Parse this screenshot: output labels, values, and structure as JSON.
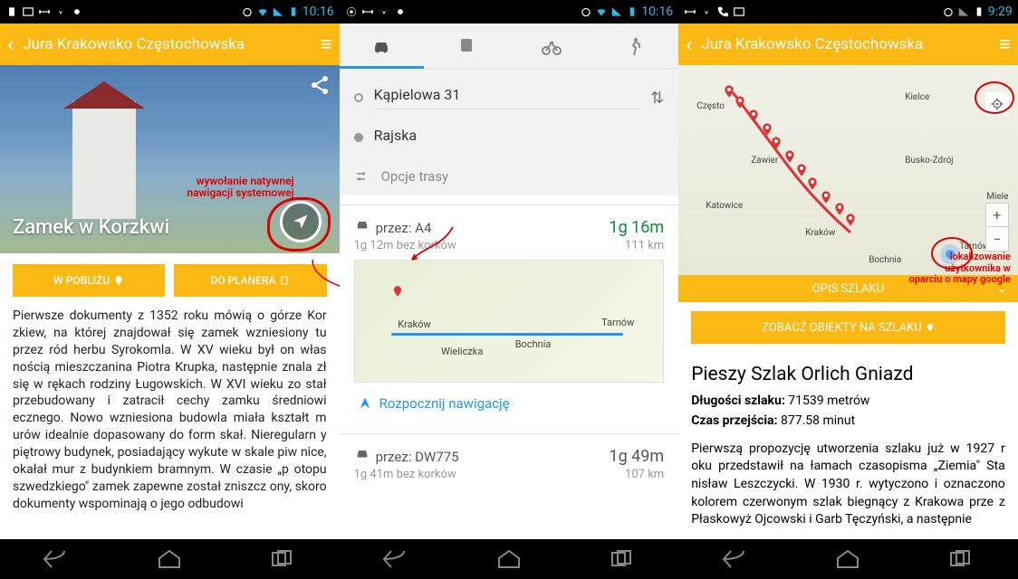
{
  "screen1": {
    "status_time": "10:16",
    "header_title": "Jura Krakowsko Częstochowska",
    "hero_title": "Zamek w Korzkwi",
    "annot_nav": "wywołanie natywnej\nnawigacji systemowej",
    "btn_nearby": "W POBLIŻU",
    "btn_planner": "DO PLANERA",
    "body": "Pierwsze dokumenty z 1352 roku mówią o górze Kor zkiew, na której znajdował się zamek wzniesiony tu przez ród herbu Syrokomla. W XV wieku był on włas nością mieszczanina Piotra Krupka, następnie znala zł się w rękach rodziny Ługowskich. W XVI wieku zo stał przebudowany i zatracił cechy zamku średniowi ecznego. Nowo wzniesiona budowla miała kształt m urów idealnie dopasowany do form skał. Nieregularn y piętrowy budynek, posiadający wykute w skale piw nice, okałał mur z budynkiem bramnym. W czasie „p otopu szwedzkiego\" zamek zapewne został zniszcz ony, skoro dokumenty wspominają o jego odbudowi"
  },
  "screen2": {
    "status_time": "10:16",
    "origin": "Kąpielowa 31",
    "dest": "Rajska",
    "options": "Opcje trasy",
    "route1_via": "przez: A4",
    "route1_time": "1g 16m",
    "route1_sub_left": "1g 12m bez korków",
    "route1_sub_right": "111 km",
    "map_cities": {
      "krakow": "Kraków",
      "wieliczka": "Wieliczka",
      "bochnia": "Bochnia",
      "tarnow": "Tarnów"
    },
    "start_nav": "Rozpocznij nawigację",
    "route2_via": "przez: DW775",
    "route2_time": "1g 49m",
    "route2_sub_left": "1g 41m bez korków",
    "route2_sub_right": "107 km"
  },
  "screen3": {
    "status_time": "9:29",
    "header_title": "Jura Krakowsko Częstochowska",
    "map_cities": {
      "czest": "Często",
      "zawier": "Zawier",
      "katowice": "Katowice",
      "krakow": "Kraków",
      "kielce": "Kielce",
      "busko": "Busko-Zdrój",
      "tarnow": "Tarnów",
      "bochnia": "Bochnia",
      "miele": "Miele"
    },
    "opis": "OPIS SZLAKU",
    "zobacz": "ZOBACZ OBIEKTY NA SZLAKU",
    "annot_loc": "lokalizowanie\nużytkownika w\noparciu o mapy google",
    "trail_title": "Pieszy Szlak Orlich Gniazd",
    "len_label": "Długości szlaku:",
    "len_val": "71539 metrów",
    "time_label": "Czas przejścia:",
    "time_val": "877.58 minut",
    "desc": " Pierwszą propozycję utworzenia szlaku już w 1927 r oku przedstawił na łamach czasopisma „Ziemia\" Sta nisław Leszczycki. W 1930 r. wytyczono i oznaczono kolorem czerwonym szlak biegnący z Krakowa prze z Płaskowyż Ojcowski i Garb Tęczyński, a następnie"
  }
}
